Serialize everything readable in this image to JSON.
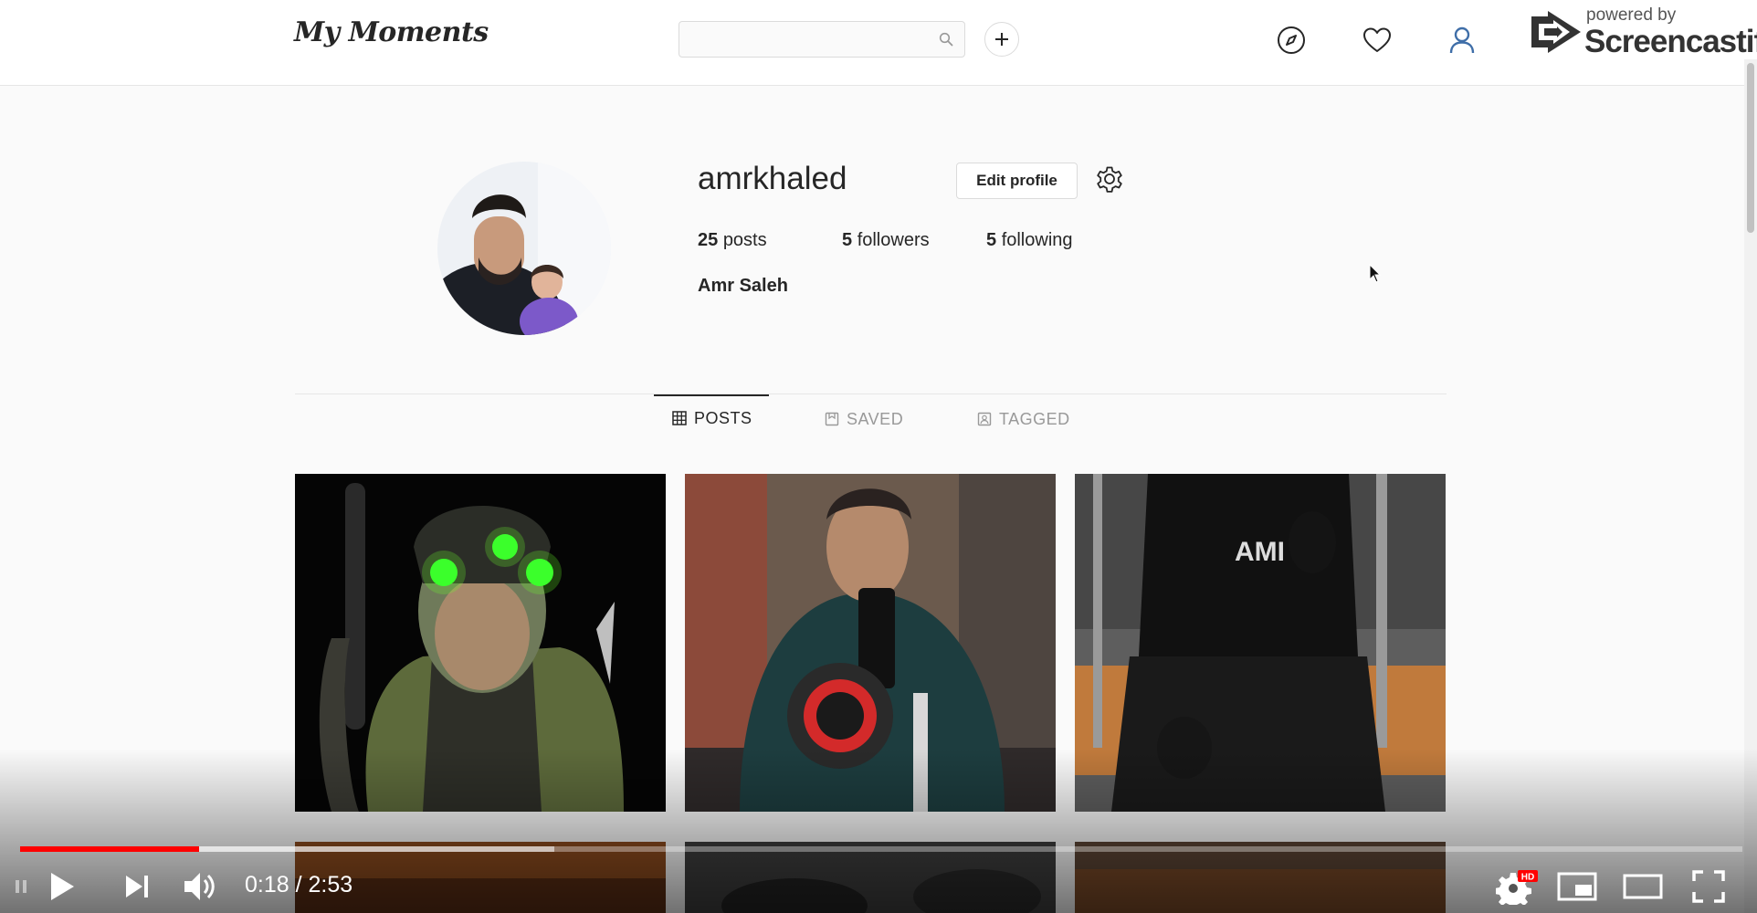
{
  "app": {
    "logo": "My Moments",
    "search_placeholder": "",
    "watermark": {
      "powered_by": "powered by",
      "brand": "Screencastify"
    }
  },
  "nav": {
    "icons": [
      "compass-icon",
      "heart-icon",
      "user-icon"
    ],
    "active_color": "#3f6ea8"
  },
  "profile": {
    "username": "amrkhaled",
    "edit_label": "Edit profile",
    "stats": {
      "posts": {
        "count": "25",
        "label": "posts"
      },
      "followers": {
        "count": "5",
        "label": "followers"
      },
      "following": {
        "count": "5",
        "label": "following"
      }
    },
    "full_name": "Amr Saleh"
  },
  "tabs": [
    {
      "label": "POSTS",
      "active": true
    },
    {
      "label": "SAVED",
      "active": false
    },
    {
      "label": "TAGGED",
      "active": false
    }
  ],
  "player": {
    "time": "0:18 / 2:53",
    "played_fraction": 0.104,
    "loaded_fraction": 0.31,
    "hd_badge": "HD",
    "accent": "#ff0000"
  }
}
